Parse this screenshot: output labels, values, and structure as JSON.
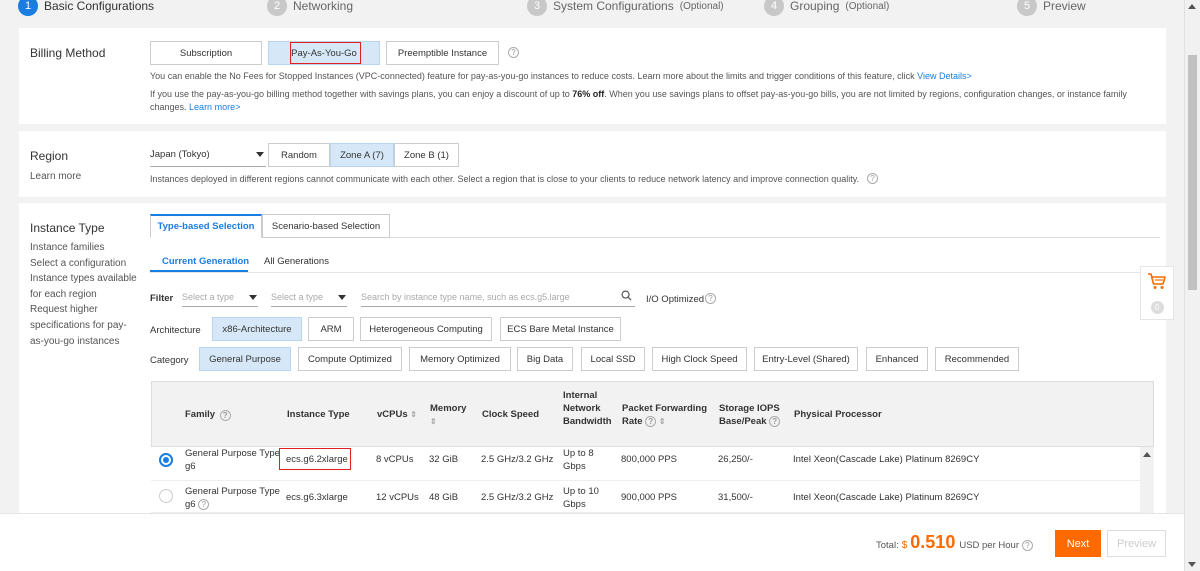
{
  "steps": [
    {
      "num": "1",
      "label": "Basic Configurations",
      "optional": ""
    },
    {
      "num": "2",
      "label": "Networking",
      "optional": ""
    },
    {
      "num": "3",
      "label": "System Configurations",
      "optional": "(Optional)"
    },
    {
      "num": "4",
      "label": "Grouping",
      "optional": "(Optional)"
    },
    {
      "num": "5",
      "label": "Preview",
      "optional": ""
    }
  ],
  "billing": {
    "label": "Billing Method",
    "options": [
      "Subscription",
      "Pay-As-You-Go",
      "Preemptible Instance"
    ],
    "selected": "Pay-As-You-Go",
    "note1": "You can enable the No Fees for Stopped Instances (VPC-connected) feature for pay-as-you-go instances to reduce costs. Learn more about the limits and trigger conditions of this feature, click",
    "note1_link": "View Details>",
    "note2a": "If you use the pay-as-you-go billing method together with savings plans, you can enjoy a discount of up to",
    "note2_bold": "76% off",
    "note2b": ". When you use savings plans to offset pay-as-you-go bills, you are not limited by regions, configuration changes, or instance family",
    "note2c": "changes.",
    "note2_link": "Learn more>"
  },
  "region": {
    "label": "Region",
    "learn_more": "Learn more",
    "selected_region": "Japan (Tokyo)",
    "zones": [
      "Random",
      "Zone A (7)",
      "Zone B (1)"
    ],
    "selected_zone": "Zone A (7)",
    "note": "Instances deployed in different regions cannot communicate with each other. Select a region that is close to your clients to reduce network latency and improve connection quality."
  },
  "instance_type": {
    "label": "Instance Type",
    "help_lines": [
      "Instance families",
      "Select a configuration",
      "Instance types available",
      "for each region",
      "Request higher",
      "specifications for pay-",
      "as-you-go instances"
    ],
    "tabs": [
      "Type-based Selection",
      "Scenario-based Selection"
    ],
    "subtabs": [
      "Current Generation",
      "All Generations"
    ],
    "filter": {
      "label": "Filter",
      "select1": "Select a type",
      "select2": "Select a type",
      "search_placeholder": "Search by instance type name, such as ecs.g5.large",
      "io_optimized": "I/O Optimized"
    },
    "architecture": {
      "label": "Architecture",
      "options": [
        "x86-Architecture",
        "ARM",
        "Heterogeneous Computing",
        "ECS Bare Metal Instance"
      ],
      "selected": "x86-Architecture"
    },
    "category": {
      "label": "Category",
      "options": [
        "General Purpose",
        "Compute Optimized",
        "Memory Optimized",
        "Big Data",
        "Local SSD",
        "High Clock Speed",
        "Entry-Level (Shared)",
        "Enhanced",
        "Recommended"
      ],
      "selected": "General Purpose"
    },
    "table": {
      "headers": {
        "family": "Family",
        "instance_type": "Instance Type",
        "vcpus": "vCPUs",
        "memory": "Memory",
        "clock_speed": "Clock Speed",
        "bandwidth": [
          "Internal",
          "Network",
          "Bandwidth"
        ],
        "pps": [
          "Packet Forwarding",
          "Rate"
        ],
        "iops": [
          "Storage IOPS",
          "Base/Peak"
        ],
        "processor": "Physical Processor"
      },
      "rows": [
        {
          "family": [
            "General Purpose Type",
            "g6"
          ],
          "instance_type": "ecs.g6.2xlarge",
          "vcpus": "8 vCPUs",
          "memory": "32 GiB",
          "clock": "2.5 GHz/3.2 GHz",
          "bandwidth": [
            "Up to 8",
            "Gbps"
          ],
          "pps": "800,000 PPS",
          "iops": "26,250/-",
          "processor": "Intel Xeon(Cascade Lake) Platinum 8269CY",
          "selected": true
        },
        {
          "family": [
            "General Purpose Type",
            "g6"
          ],
          "instance_type": "ecs.g6.3xlarge",
          "vcpus": "12 vCPUs",
          "memory": "48 GiB",
          "clock": "2.5 GHz/3.2 GHz",
          "bandwidth": [
            "Up to 10",
            "Gbps"
          ],
          "pps": "900,000 PPS",
          "iops": "31,500/-",
          "processor": "Intel Xeon(Cascade Lake) Platinum 8269CY",
          "selected": false
        }
      ]
    }
  },
  "cart": {
    "count": "0"
  },
  "footer": {
    "total_label": "Total:",
    "currency": "$",
    "price": "0.510",
    "unit": "USD per Hour",
    "next": "Next",
    "preview": "Preview"
  },
  "colors": {
    "accent": "#1a7de1",
    "orange": "#ff6a00",
    "highlight": "#e02020"
  }
}
